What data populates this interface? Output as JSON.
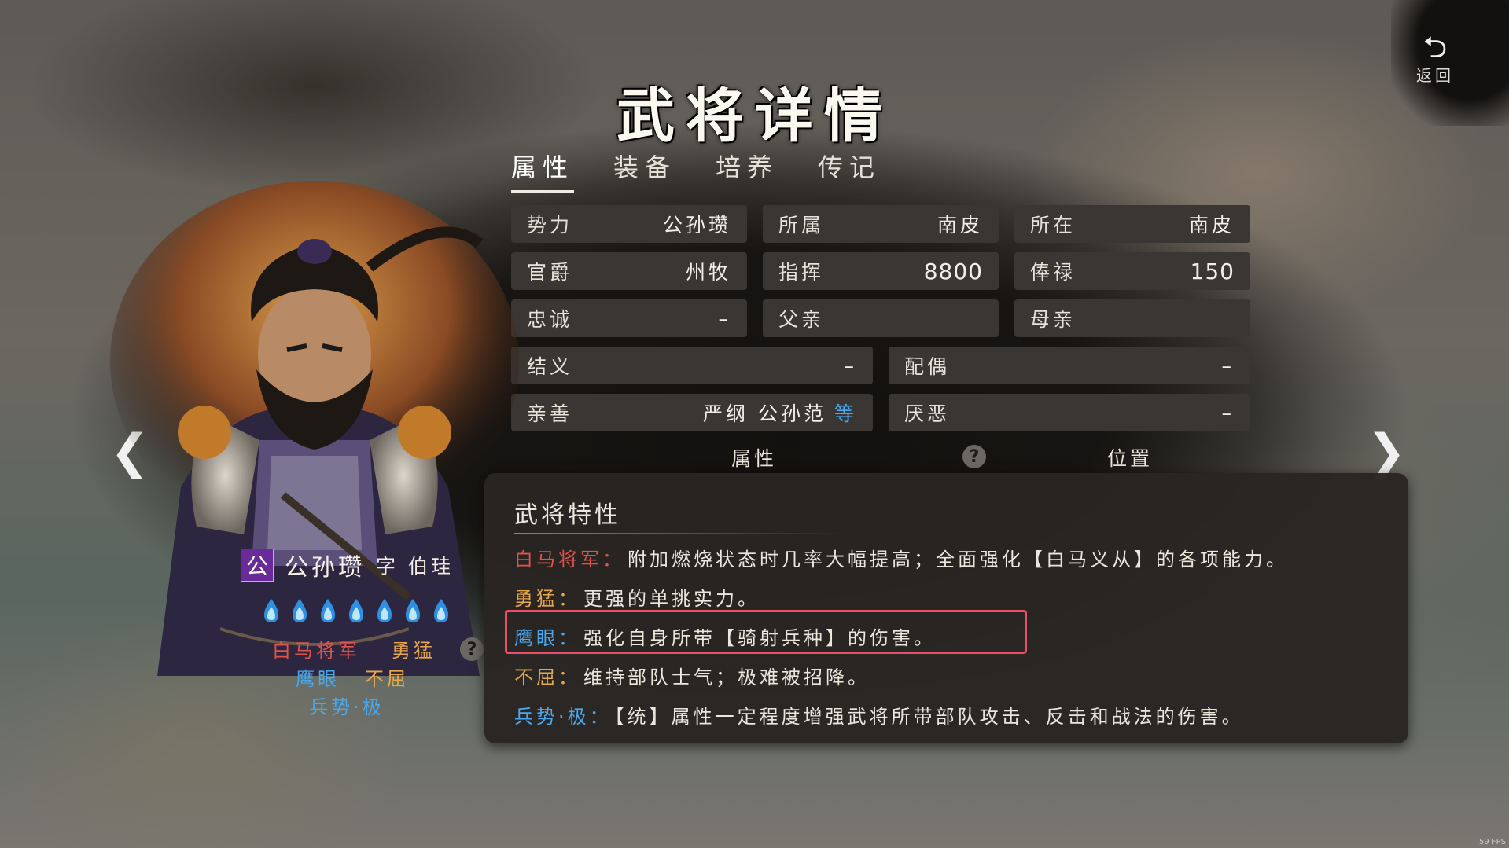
{
  "window": {
    "title": "武将详情",
    "back_label": "返回",
    "fps": "59 FPS"
  },
  "tabs": [
    {
      "label": "属性",
      "active": true
    },
    {
      "label": "装备",
      "active": false
    },
    {
      "label": "培养",
      "active": false
    },
    {
      "label": "传记",
      "active": false
    }
  ],
  "general": {
    "faction_badge": "公",
    "name": "公孙瓒",
    "courtesy_name": "字 伯珪",
    "stars": 7,
    "traits": {
      "row1": [
        {
          "label": "白马将军",
          "color": "#e0524a"
        },
        {
          "label": "勇猛",
          "color": "#e8a84a"
        }
      ],
      "row2": [
        {
          "label": "鹰眼",
          "color": "#4aa8ee"
        },
        {
          "label": "不屈",
          "color": "#e8a84a"
        }
      ],
      "row3": [
        {
          "label": "兵势·极",
          "color": "#4aa8ee"
        }
      ]
    }
  },
  "info": {
    "shili": {
      "key": "势力",
      "value": "公孙瓒"
    },
    "suoshu": {
      "key": "所属",
      "value": "南皮"
    },
    "suozai": {
      "key": "所在",
      "value": "南皮"
    },
    "guanjue": {
      "key": "官爵",
      "value": "州牧"
    },
    "zhihui": {
      "key": "指挥",
      "value": "8800"
    },
    "fenglu": {
      "key": "俸禄",
      "value": "150"
    },
    "zhongcheng": {
      "key": "忠诚",
      "value": "–"
    },
    "fuqin": {
      "key": "父亲",
      "value": ""
    },
    "muqin": {
      "key": "母亲",
      "value": ""
    },
    "jieyi": {
      "key": "结义",
      "value": "–"
    },
    "peiou": {
      "key": "配偶",
      "value": "–"
    },
    "qinshan": {
      "key": "亲善",
      "value": "严纲 公孙范",
      "more": "等"
    },
    "yanwu": {
      "key": "厌恶",
      "value": "–"
    }
  },
  "sections": {
    "attributes": "属性",
    "position": "位置"
  },
  "popup": {
    "title": "武将特性",
    "items": [
      {
        "name": "白马将军：",
        "desc": "附加燃烧状态时几率大幅提高；全面强化【白马义从】的各项能力。",
        "color": "#e0524a"
      },
      {
        "name": "勇猛：",
        "desc": "更强的单挑实力。",
        "color": "#e8a84a"
      },
      {
        "name": "鹰眼：",
        "desc": "强化自身所带【骑射兵种】的伤害。",
        "color": "#4aa8ee"
      },
      {
        "name": "不屈：",
        "desc": "维持部队士气；极难被招降。",
        "color": "#e8a84a"
      },
      {
        "name": "兵势·极：",
        "desc": "【统】属性一定程度增强武将所带部队攻击、反击和战法的伤害。",
        "color": "#4aa8ee"
      }
    ]
  },
  "colors": {
    "accent_red": "#e0524a",
    "accent_gold": "#e8a84a",
    "accent_blue": "#4aa8ee",
    "highlight": "#e8506a"
  }
}
